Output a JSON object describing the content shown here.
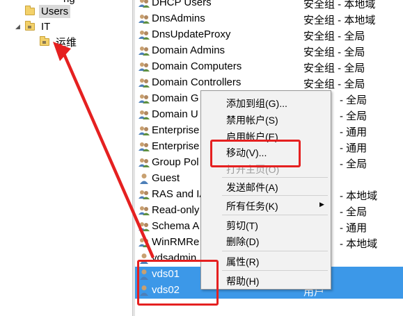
{
  "tree": {
    "top_partial": "ng",
    "users": "Users",
    "it": "IT",
    "yunwei": "运维"
  },
  "list": {
    "rows": [
      {
        "name": "DHCP Users",
        "type": "安全组 - 本地域",
        "icon": "group-icon"
      },
      {
        "name": "DnsAdmins",
        "type": "安全组 - 本地域",
        "icon": "group-icon"
      },
      {
        "name": "DnsUpdateProxy",
        "type": "安全组 - 全局",
        "icon": "group-icon"
      },
      {
        "name": "Domain Admins",
        "type": "安全组 - 全局",
        "icon": "group-icon"
      },
      {
        "name": "Domain Computers",
        "type": "安全组 - 全局",
        "icon": "group-icon"
      },
      {
        "name": "Domain Controllers",
        "type": "安全组 - 全局",
        "icon": "group-icon"
      },
      {
        "name": "Domain G",
        "type": "- 全局",
        "icon": "group-icon"
      },
      {
        "name": "Domain U",
        "type": "- 全局",
        "icon": "group-icon"
      },
      {
        "name": "Enterprise",
        "type": "- 通用",
        "icon": "group-icon"
      },
      {
        "name": "Enterprise",
        "type": "- 通用",
        "icon": "group-icon"
      },
      {
        "name": "Group Pol",
        "type": "- 全局",
        "icon": "group-icon"
      },
      {
        "name": "Guest",
        "type": "",
        "icon": "user-icon"
      },
      {
        "name": "RAS and IA",
        "type": "- 本地域",
        "icon": "group-icon"
      },
      {
        "name": "Read-only",
        "type": "- 全局",
        "icon": "group-icon"
      },
      {
        "name": "Schema A",
        "type": "- 通用",
        "icon": "group-icon"
      },
      {
        "name": "WinRMRe",
        "type": "- 本地域",
        "icon": "group-icon"
      },
      {
        "name": "vdsadmin",
        "type": "",
        "icon": "user-icon"
      },
      {
        "name": "vds01",
        "type": "",
        "icon": "user-icon"
      },
      {
        "name": "vds02",
        "type": "用户",
        "icon": "user-icon"
      }
    ]
  },
  "context_menu": {
    "add_to_group": "添加到组(G)...",
    "disable_account": "禁用帐户(S)",
    "enable_account": "启用帐户(E)",
    "move": "移动(V)...",
    "open_home": "打开主页(O)",
    "send_mail": "发送邮件(A)",
    "all_tasks": "所有任务(K)",
    "cut": "剪切(T)",
    "delete": "删除(D)",
    "properties": "属性(R)",
    "help": "帮助(H)"
  },
  "colors": {
    "selection": "#3c98e8",
    "annotation_red": "#e52020",
    "menu_background": "#f2f2f2"
  }
}
